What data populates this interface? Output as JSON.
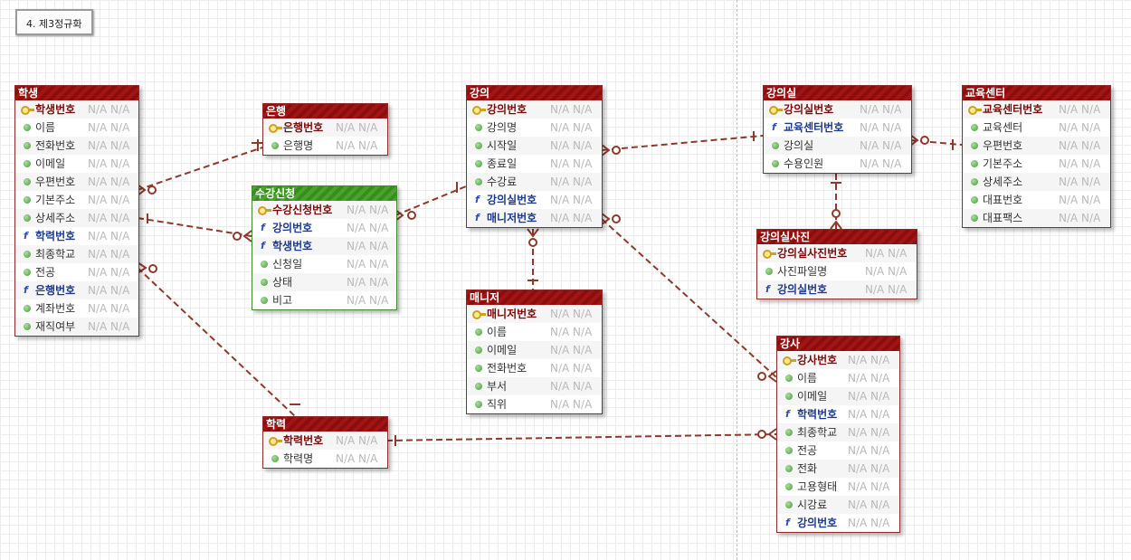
{
  "diagram_title": "4. 제3정규화",
  "placeholder": "N/A N/A",
  "fk_glyph": "f",
  "colors": {
    "entity_header": "#a31515",
    "link_entity_header": "#4aa42a",
    "relation_line": "#8b3a2b"
  },
  "entities": {
    "student": {
      "title": "학생",
      "rows": [
        {
          "name": "학생번호",
          "kind": "pk"
        },
        {
          "name": "이름",
          "kind": "attr"
        },
        {
          "name": "전화번호",
          "kind": "attr"
        },
        {
          "name": "이메일",
          "kind": "attr"
        },
        {
          "name": "우편번호",
          "kind": "attr"
        },
        {
          "name": "기본주소",
          "kind": "attr"
        },
        {
          "name": "상세주소",
          "kind": "attr"
        },
        {
          "name": "학력번호",
          "kind": "fk"
        },
        {
          "name": "최종학교",
          "kind": "attr"
        },
        {
          "name": "전공",
          "kind": "attr"
        },
        {
          "name": "은행번호",
          "kind": "fk"
        },
        {
          "name": "계좌번호",
          "kind": "attr"
        },
        {
          "name": "재직여부",
          "kind": "attr"
        }
      ]
    },
    "bank": {
      "title": "은행",
      "rows": [
        {
          "name": "은행번호",
          "kind": "pk"
        },
        {
          "name": "은행명",
          "kind": "attr"
        }
      ]
    },
    "enrollment": {
      "title": "수강신청",
      "rows": [
        {
          "name": "수강신청번호",
          "kind": "pk"
        },
        {
          "name": "강의번호",
          "kind": "fk"
        },
        {
          "name": "학생번호",
          "kind": "fk"
        },
        {
          "name": "신청일",
          "kind": "attr"
        },
        {
          "name": "상태",
          "kind": "attr"
        },
        {
          "name": "비고",
          "kind": "attr"
        }
      ]
    },
    "lecture": {
      "title": "강의",
      "rows": [
        {
          "name": "강의번호",
          "kind": "pk"
        },
        {
          "name": "강의명",
          "kind": "attr"
        },
        {
          "name": "시작일",
          "kind": "attr"
        },
        {
          "name": "종료일",
          "kind": "attr"
        },
        {
          "name": "수강료",
          "kind": "attr"
        },
        {
          "name": "강의실번호",
          "kind": "fk"
        },
        {
          "name": "매니저번호",
          "kind": "fk"
        }
      ]
    },
    "manager": {
      "title": "매니저",
      "rows": [
        {
          "name": "매니저번호",
          "kind": "pk"
        },
        {
          "name": "이름",
          "kind": "attr"
        },
        {
          "name": "이메일",
          "kind": "attr"
        },
        {
          "name": "전화번호",
          "kind": "attr"
        },
        {
          "name": "부서",
          "kind": "attr"
        },
        {
          "name": "직위",
          "kind": "attr"
        }
      ]
    },
    "education": {
      "title": "학력",
      "rows": [
        {
          "name": "학력번호",
          "kind": "pk"
        },
        {
          "name": "학력명",
          "kind": "attr"
        }
      ]
    },
    "classroom": {
      "title": "강의실",
      "rows": [
        {
          "name": "강의실번호",
          "kind": "pk"
        },
        {
          "name": "교육센터번호",
          "kind": "fk"
        },
        {
          "name": "강의실",
          "kind": "attr"
        },
        {
          "name": "수용인원",
          "kind": "attr"
        }
      ]
    },
    "center": {
      "title": "교육센터",
      "rows": [
        {
          "name": "교육센터번호",
          "kind": "pk"
        },
        {
          "name": "교육센터",
          "kind": "attr"
        },
        {
          "name": "우편번호",
          "kind": "attr"
        },
        {
          "name": "기본주소",
          "kind": "attr"
        },
        {
          "name": "상세주소",
          "kind": "attr"
        },
        {
          "name": "대표번호",
          "kind": "attr"
        },
        {
          "name": "대표팩스",
          "kind": "attr"
        }
      ]
    },
    "classroom_photo": {
      "title": "강의실사진",
      "rows": [
        {
          "name": "강의실사진번호",
          "kind": "pk"
        },
        {
          "name": "사진파일명",
          "kind": "attr"
        },
        {
          "name": "강의실번호",
          "kind": "fk"
        }
      ]
    },
    "instructor": {
      "title": "강사",
      "rows": [
        {
          "name": "강사번호",
          "kind": "pk"
        },
        {
          "name": "이름",
          "kind": "attr"
        },
        {
          "name": "이메일",
          "kind": "attr"
        },
        {
          "name": "학력번호",
          "kind": "fk"
        },
        {
          "name": "최종학교",
          "kind": "attr"
        },
        {
          "name": "전공",
          "kind": "attr"
        },
        {
          "name": "전화",
          "kind": "attr"
        },
        {
          "name": "고용형태",
          "kind": "attr"
        },
        {
          "name": "시강료",
          "kind": "attr"
        },
        {
          "name": "강의번호",
          "kind": "fk"
        }
      ]
    }
  },
  "relationships": [
    {
      "from": "bank",
      "to": "student",
      "cardinality": "one-to-many"
    },
    {
      "from": "student",
      "to": "enrollment",
      "cardinality": "one-to-many"
    },
    {
      "from": "lecture",
      "to": "enrollment",
      "cardinality": "one-to-many"
    },
    {
      "from": "classroom",
      "to": "lecture",
      "cardinality": "one-to-many"
    },
    {
      "from": "center",
      "to": "classroom",
      "cardinality": "one-to-many"
    },
    {
      "from": "classroom",
      "to": "classroom_photo",
      "cardinality": "one-to-many"
    },
    {
      "from": "manager",
      "to": "lecture",
      "cardinality": "one-to-many"
    },
    {
      "from": "education",
      "to": "student",
      "cardinality": "one-to-many"
    },
    {
      "from": "education",
      "to": "instructor",
      "cardinality": "one-to-many"
    },
    {
      "from": "lecture",
      "to": "instructor",
      "cardinality": "one-to-many"
    }
  ]
}
